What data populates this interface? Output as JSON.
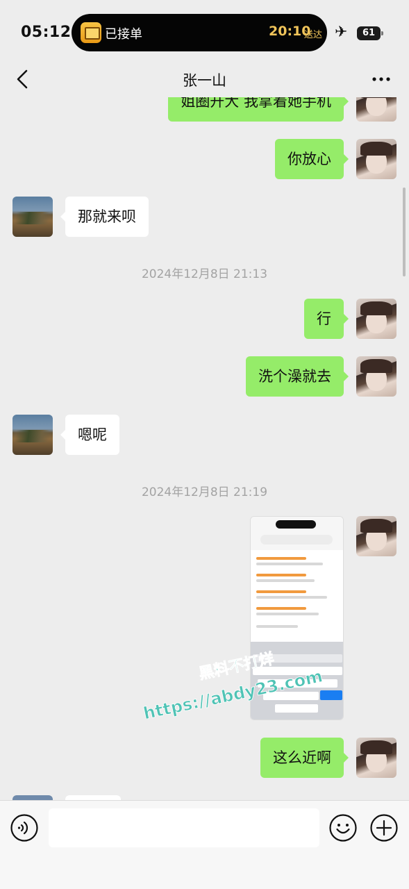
{
  "status_bar": {
    "time": "05:12",
    "island_label": "已接单",
    "island_time": "20:10",
    "island_sub": "送达",
    "battery": "61"
  },
  "nav": {
    "title": "张一山"
  },
  "messages": [
    {
      "side": "self",
      "text": "姐圈开大 我拿着她手机"
    },
    {
      "side": "self",
      "text": "你放心"
    },
    {
      "side": "other",
      "text": "那就来呗"
    },
    {
      "type": "timestamp",
      "text": "2024年12月8日 21:13"
    },
    {
      "side": "self",
      "text": "行"
    },
    {
      "side": "self",
      "text": "洗个澡就去"
    },
    {
      "side": "other",
      "text": "嗯呢"
    },
    {
      "type": "timestamp",
      "text": "2024年12月8日 21:19"
    },
    {
      "side": "self",
      "type": "image"
    },
    {
      "side": "self",
      "text": "这么近啊"
    }
  ],
  "watermark": {
    "line1": "黑料不打烊",
    "line2": "https://abdy23.com"
  },
  "input_bar": {
    "text_value": ""
  }
}
